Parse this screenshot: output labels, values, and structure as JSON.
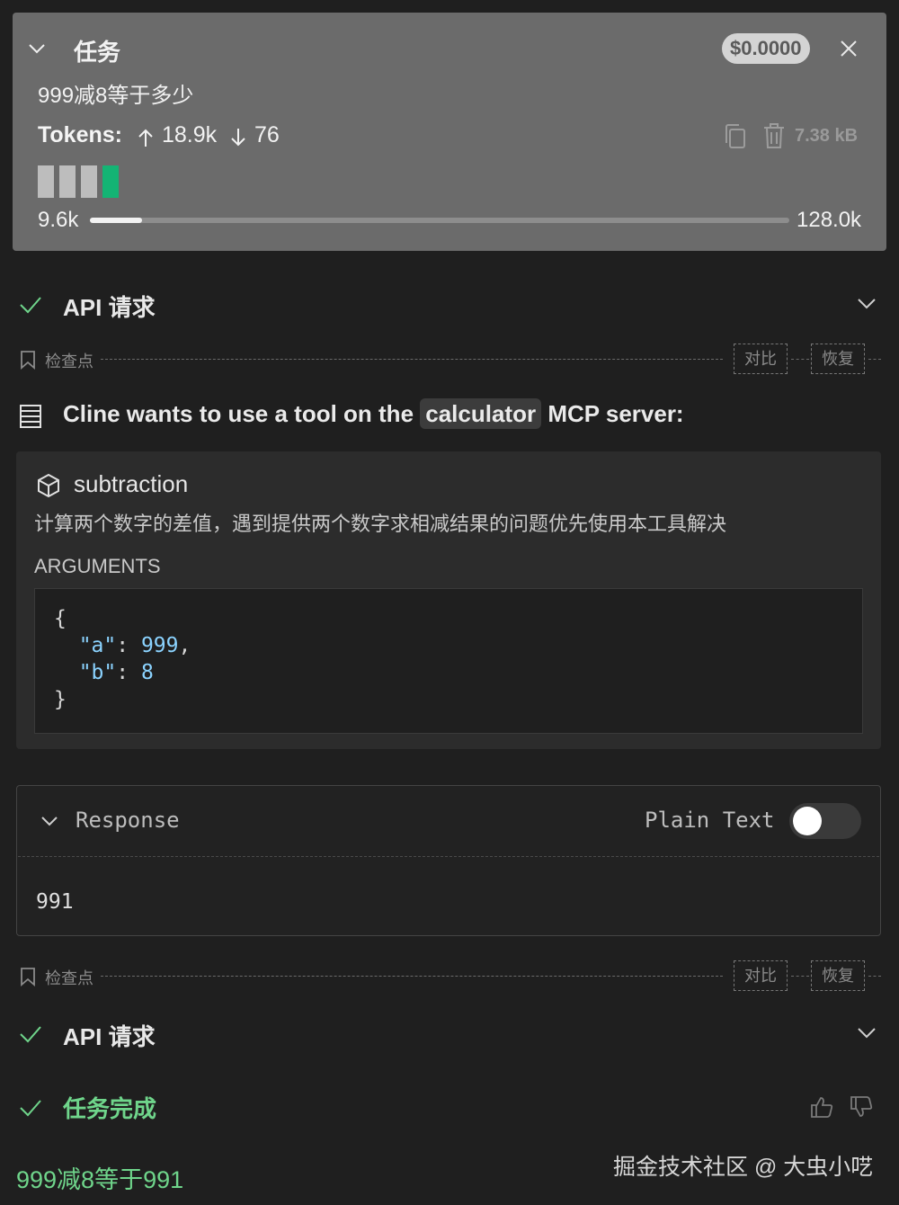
{
  "task": {
    "title": "任务",
    "cost": "$0.0000",
    "question": "999减8等于多少",
    "tokens_label": "Tokens:",
    "tokens_in": "18.9k",
    "tokens_out": "76",
    "size": "7.38 kB",
    "context_used": "9.6k",
    "context_max": "128.0k",
    "context_fraction": 0.075
  },
  "api_request_label": "API 请求",
  "checkpoint": {
    "label": "检查点",
    "compare": "对比",
    "restore": "恢复"
  },
  "tool": {
    "header_prefix": "Cline wants to use a tool on the",
    "server_name": "calculator",
    "header_suffix": "MCP server:",
    "name": "subtraction",
    "description": "计算两个数字的差值，遇到提供两个数字求相减结果的问题优先使用本工具解决",
    "arguments_label": "ARGUMENTS",
    "arguments": {
      "a": "999",
      "b": "8"
    }
  },
  "response": {
    "title": "Response",
    "plain_text_label": "Plain Text",
    "plain_text_enabled": false,
    "value": "991"
  },
  "completion": {
    "label": "任务完成",
    "answer": "999减8等于991"
  },
  "watermark": "掘金技术社区 @ 大虫小呓",
  "colors": {
    "accent_green": "#6fd58b",
    "segment_green": "#14b474",
    "task_bg": "#6b6b6b",
    "page_bg": "#1f1f1f"
  },
  "icons": [
    "chevron-down-icon",
    "close-icon",
    "arrow-up-icon",
    "arrow-down-icon",
    "copy-icon",
    "trash-icon",
    "check-icon",
    "bookmark-icon",
    "server-icon",
    "cube-icon",
    "thumb-up-icon",
    "thumb-down-icon"
  ]
}
